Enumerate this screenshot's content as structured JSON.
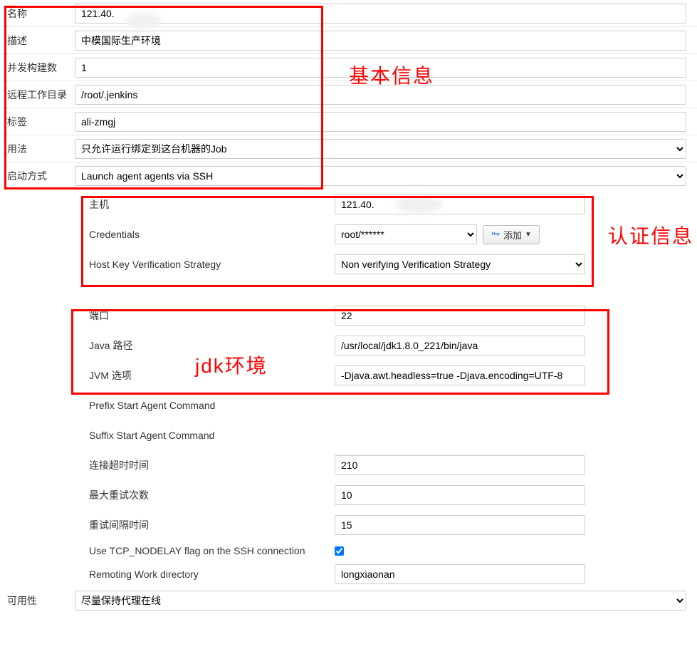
{
  "basic": {
    "name_label": "名称",
    "name_value": "121.40.",
    "desc_label": "描述",
    "desc_value": "中模国际生产环境",
    "executors_label": "并发构建数",
    "executors_value": "1",
    "remote_fs_label": "远程工作目录",
    "remote_fs_value": "/root/.jenkins",
    "labels_label": "标签",
    "labels_value": "ali-zmgj",
    "usage_label": "用法",
    "usage_value": "只允许运行绑定到这台机器的Job",
    "launch_label": "启动方式",
    "launch_value": "Launch agent agents via SSH"
  },
  "auth": {
    "host_label": "主机",
    "host_value": "121.40.",
    "cred_label": "Credentials",
    "cred_value": "root/******",
    "add_button": "添加",
    "hostkey_label": "Host Key Verification Strategy",
    "hostkey_value": "Non verifying Verification Strategy"
  },
  "jdk": {
    "port_label": "端口",
    "port_value": "22",
    "java_path_label": "Java 路径",
    "java_path_value": "/usr/local/jdk1.8.0_221/bin/java",
    "jvm_opts_label": "JVM 选项",
    "jvm_opts_value": "-Djava.awt.headless=true -Djava.encoding=UTF-8"
  },
  "advanced": {
    "prefix_label": "Prefix Start Agent Command",
    "suffix_label": "Suffix Start Agent Command",
    "conn_timeout_label": "连接超时时间",
    "conn_timeout_value": "210",
    "max_retries_label": "最大重试次数",
    "max_retries_value": "10",
    "retry_wait_label": "重试间隔时间",
    "retry_wait_value": "15",
    "tcp_nodelay_label": "Use TCP_NODELAY flag on the SSH connection",
    "remoting_dir_label": "Remoting Work directory",
    "remoting_dir_value": "longxiaonan"
  },
  "availability": {
    "label": "可用性",
    "value": "尽量保持代理在线"
  },
  "annotations": {
    "basic_title": "基本信息",
    "auth_title": "认证信息",
    "jdk_title": "jdk环境"
  }
}
